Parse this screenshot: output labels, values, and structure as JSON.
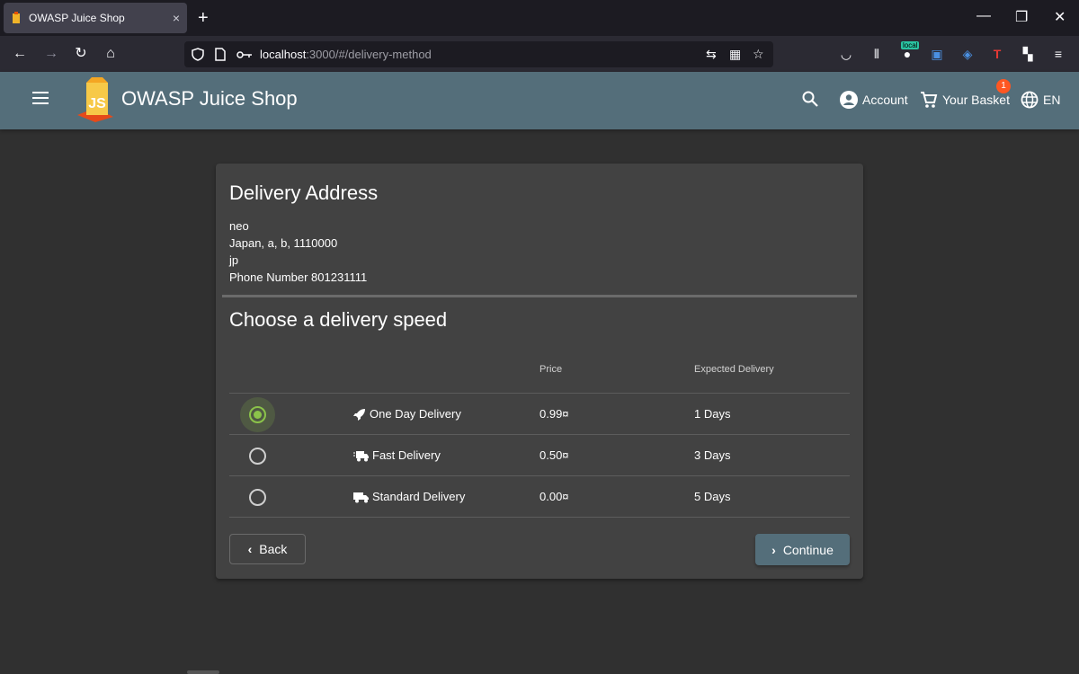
{
  "browser": {
    "tab_title": "OWASP Juice Shop",
    "tab_close": "×",
    "new_tab": "+",
    "url_host": "localhost",
    "url_path": ":3000/#/delivery-method",
    "ext_badge": "local"
  },
  "app": {
    "title": "OWASP Juice Shop",
    "logo_text": "JS",
    "account_label": "Account",
    "basket_label": "Your Basket",
    "basket_count": "1",
    "language_label": "EN"
  },
  "address": {
    "heading": "Delivery Address",
    "lines": [
      "neo",
      "Japan, a, b, 1110000",
      "jp",
      "Phone Number 801231111"
    ]
  },
  "delivery": {
    "heading": "Choose a delivery speed",
    "columns": {
      "price": "Price",
      "expected": "Expected Delivery"
    },
    "options": [
      {
        "name": "One Day Delivery",
        "price": "0.99¤",
        "days": "1 Days",
        "icon": "rocket-icon",
        "selected": true
      },
      {
        "name": "Fast Delivery",
        "price": "0.50¤",
        "days": "3 Days",
        "icon": "shipping-fast-icon",
        "selected": false
      },
      {
        "name": "Standard Delivery",
        "price": "0.00¤",
        "days": "5 Days",
        "icon": "truck-icon",
        "selected": false
      }
    ]
  },
  "actions": {
    "back_label": "Back",
    "continue_label": "Continue"
  },
  "colors": {
    "toolbar": "#546e7a",
    "accent": "#8bc34a",
    "badge": "#ff5722",
    "card": "#424242",
    "background": "#303030"
  }
}
